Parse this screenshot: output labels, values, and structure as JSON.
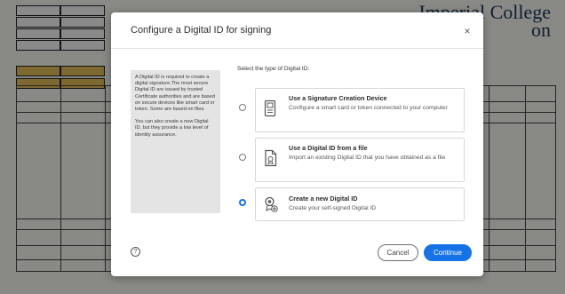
{
  "background": {
    "brand_line1": "Imperial College",
    "brand_line2": "on"
  },
  "dialog": {
    "title": "Configure a Digital ID for signing",
    "info_paragraph_1": "A Digital ID is required to create a digital signature.The most secure Digital ID are issued by trusted Certificate authorities and are based on secure devices like smart card or token. Some are based on files.",
    "info_paragraph_2": "You can also create a new Digital ID, but they provide a low level of identity assurance.",
    "prompt": "Select the type of Digital ID:",
    "options": [
      {
        "title": "Use a Signature Creation Device",
        "description": "Configure a smart card or token connected to your computer",
        "icon": "card-reader-icon",
        "selected": false
      },
      {
        "title": "Use a Digital ID from a file",
        "description": "Import an existing Digital ID that you have obtained as a file",
        "icon": "certificate-file-icon",
        "selected": false
      },
      {
        "title": "Create a new Digital ID",
        "description": "Create your self-signed Digital ID",
        "icon": "new-id-badge-icon",
        "selected": true
      }
    ],
    "help_glyph": "?",
    "close_glyph": "×",
    "cancel_label": "Cancel",
    "continue_label": "Continue",
    "accent_color": "#1473e6"
  }
}
